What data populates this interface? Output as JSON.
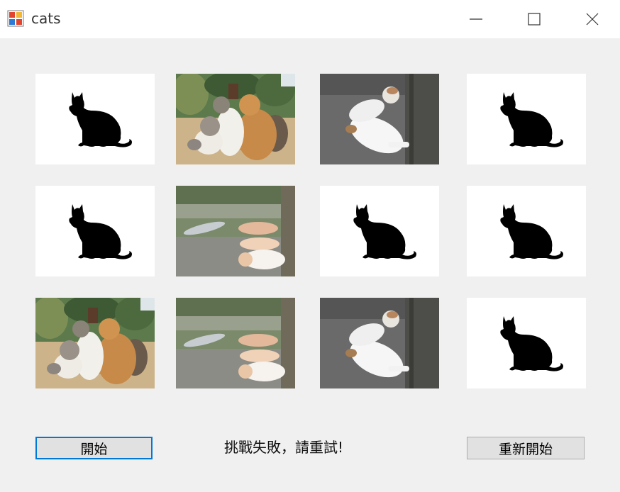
{
  "window": {
    "title": "cats",
    "icons": {
      "app": "app-icon",
      "minimize": "minimize-icon",
      "maximize": "maximize-icon",
      "close": "close-icon"
    }
  },
  "board": {
    "cards": [
      {
        "face": "hidden",
        "icon": "cat-silhouette-icon"
      },
      {
        "face": "photo",
        "image": "cats-group-photo"
      },
      {
        "face": "photo",
        "image": "cat-lying-photo"
      },
      {
        "face": "hidden",
        "icon": "cat-silhouette-icon"
      },
      {
        "face": "hidden",
        "icon": "cat-silhouette-icon"
      },
      {
        "face": "photo",
        "image": "cats-stretching-photo"
      },
      {
        "face": "hidden",
        "icon": "cat-silhouette-icon"
      },
      {
        "face": "hidden",
        "icon": "cat-silhouette-icon"
      },
      {
        "face": "photo",
        "image": "cats-group-photo"
      },
      {
        "face": "photo",
        "image": "cats-stretching-photo"
      },
      {
        "face": "photo",
        "image": "cat-lying-photo"
      },
      {
        "face": "hidden",
        "icon": "cat-silhouette-icon"
      }
    ]
  },
  "controls": {
    "start_label": "開始",
    "status_text": "挑戰失敗，請重試!",
    "restart_label": "重新開始"
  },
  "colors": {
    "focus_border": "#0078d7",
    "window_bg": "#f0f0f0",
    "button_bg": "#e1e1e1"
  }
}
